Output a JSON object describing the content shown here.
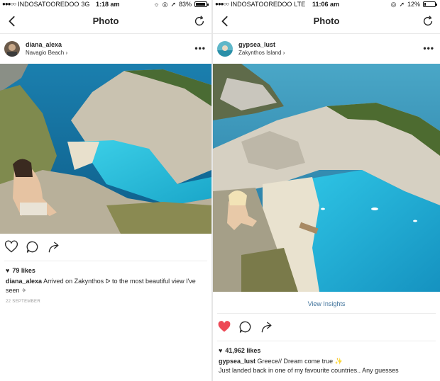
{
  "left": {
    "status": {
      "carrier": "INDOSATOOREDOO",
      "network": "3G",
      "time": "1:18 am",
      "battery": "83%",
      "battery_level": 0.83
    },
    "nav": {
      "title": "Photo"
    },
    "post": {
      "username": "diana_alexa",
      "location": "Navagio Beach",
      "likes": "79 likes",
      "caption_user": "diana_alexa",
      "caption_text": "Arrived on Zakynthos ᐅ to the most beautiful view I've seen ✧",
      "date": "22 SEPTEMBER"
    }
  },
  "right": {
    "status": {
      "carrier": "INDOSATOOREDOO",
      "network": "LTE",
      "time": "11:06 am",
      "battery": "12%",
      "battery_level": 0.12
    },
    "nav": {
      "title": "Photo"
    },
    "post": {
      "username": "gypsea_lust",
      "location": "Zakynthos Island",
      "insights": "View Insights",
      "likes": "41,962 likes",
      "caption_user": "gypsea_lust",
      "caption_text": "Greece// Dream come true ✨",
      "caption_line2": "Just landed back in one of my favourite countries.. Any guesses"
    }
  },
  "icons": [
    "back-chevron-icon",
    "refresh-icon",
    "more-icon",
    "heart-icon",
    "comment-icon",
    "share-icon",
    "location-arrow-icon",
    "alarm-icon"
  ],
  "colors": {
    "liked_heart": "#ed4956",
    "insights_link": "#3f729b",
    "sea": "#1aa6c9"
  }
}
